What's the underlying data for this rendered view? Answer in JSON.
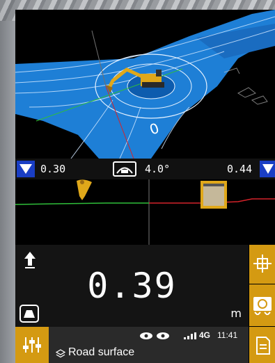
{
  "measure_strip": {
    "left_value": "0.30",
    "tilt_value": "4.0°",
    "right_value": "0.44"
  },
  "viewport": {
    "road_marker": "0"
  },
  "readout": {
    "value": "0.39",
    "unit": "m"
  },
  "status_bar": {
    "network": "4G",
    "time": "11:41",
    "surface_label": "Road surface"
  },
  "colors": {
    "accent": "#d49a12",
    "selector_blue": "#1a3ec4",
    "road_blue": "#1e7fd6",
    "terrain_green": "#2fbf3a",
    "terrain_red": "#d6232a"
  },
  "icons": {
    "left_selector": "triangle-down-icon",
    "tilt": "bucket-tilt-icon",
    "right_selector": "triangle-down-icon",
    "up": "arrow-up-icon",
    "target": "target-surface-icon",
    "crosshair": "crosshair-grid-icon",
    "swap": "swap-view-icon",
    "document": "document-icon",
    "settings": "sliders-icon",
    "eye_left": "eye-icon",
    "eye_right": "eye-icon",
    "signal": "signal-icon",
    "layers": "layers-icon"
  }
}
